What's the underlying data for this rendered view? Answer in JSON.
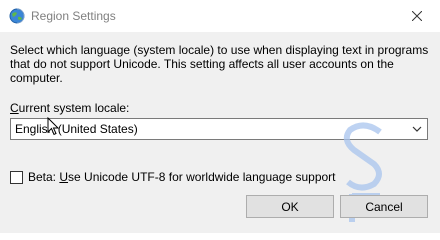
{
  "window": {
    "title": "Region Settings",
    "icon": "globe-icon",
    "close_icon": "close-icon"
  },
  "description": "Select which language (system locale) to use when displaying text in programs that do not support Unicode. This setting affects all user accounts on the computer.",
  "locale": {
    "label_prefix": "",
    "label_accel": "C",
    "label_rest": "urrent system locale:",
    "selected": "English (United States)",
    "arrow_icon": "chevron-down-icon"
  },
  "beta": {
    "checked": false,
    "label_prefix": "Beta: ",
    "label_accel": "U",
    "label_rest": "se Unicode UTF-8 for worldwide language support"
  },
  "buttons": {
    "ok": "OK",
    "cancel": "Cancel"
  },
  "watermark": {
    "text": "SF",
    "color": "#a8c4ee"
  }
}
